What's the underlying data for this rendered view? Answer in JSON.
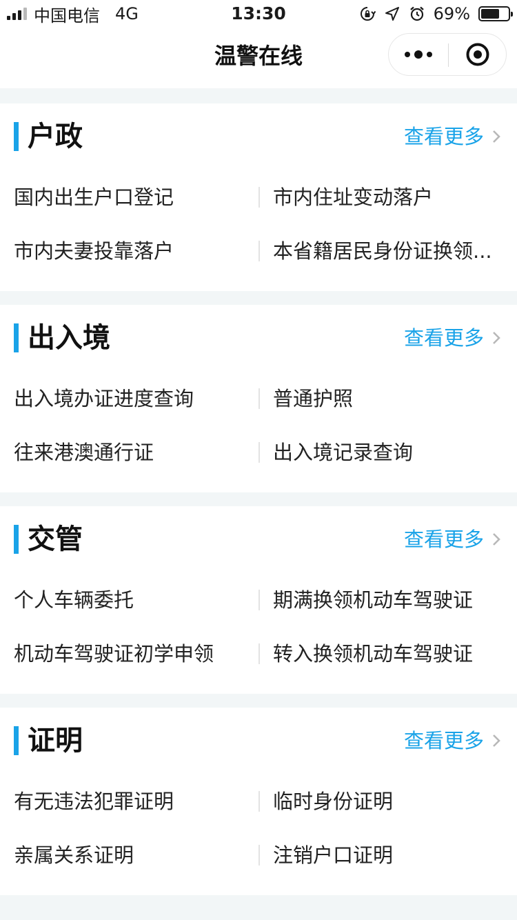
{
  "status": {
    "carrier": "中国电信",
    "network": "4G",
    "time": "13:30",
    "battery": "69%",
    "battery_level": 0.69
  },
  "nav": {
    "title": "温警在线"
  },
  "colors": {
    "accent": "#1aa3e8",
    "background": "#f2f6f7"
  },
  "sections": [
    {
      "title": "户政",
      "more": "查看更多",
      "items": [
        "国内出生户口登记",
        "市内住址变动落户",
        "市内夫妻投靠落户",
        "本省籍居民身份证换领..."
      ]
    },
    {
      "title": "出入境",
      "more": "查看更多",
      "items": [
        "出入境办证进度查询",
        "普通护照",
        "往来港澳通行证",
        "出入境记录查询"
      ]
    },
    {
      "title": "交管",
      "more": "查看更多",
      "items": [
        "个人车辆委托",
        "期满换领机动车驾驶证",
        "机动车驾驶证初学申领",
        "转入换领机动车驾驶证"
      ]
    },
    {
      "title": "证明",
      "more": "查看更多",
      "items": [
        "有无违法犯罪证明",
        "临时身份证明",
        "亲属关系证明",
        "注销户口证明"
      ]
    }
  ]
}
